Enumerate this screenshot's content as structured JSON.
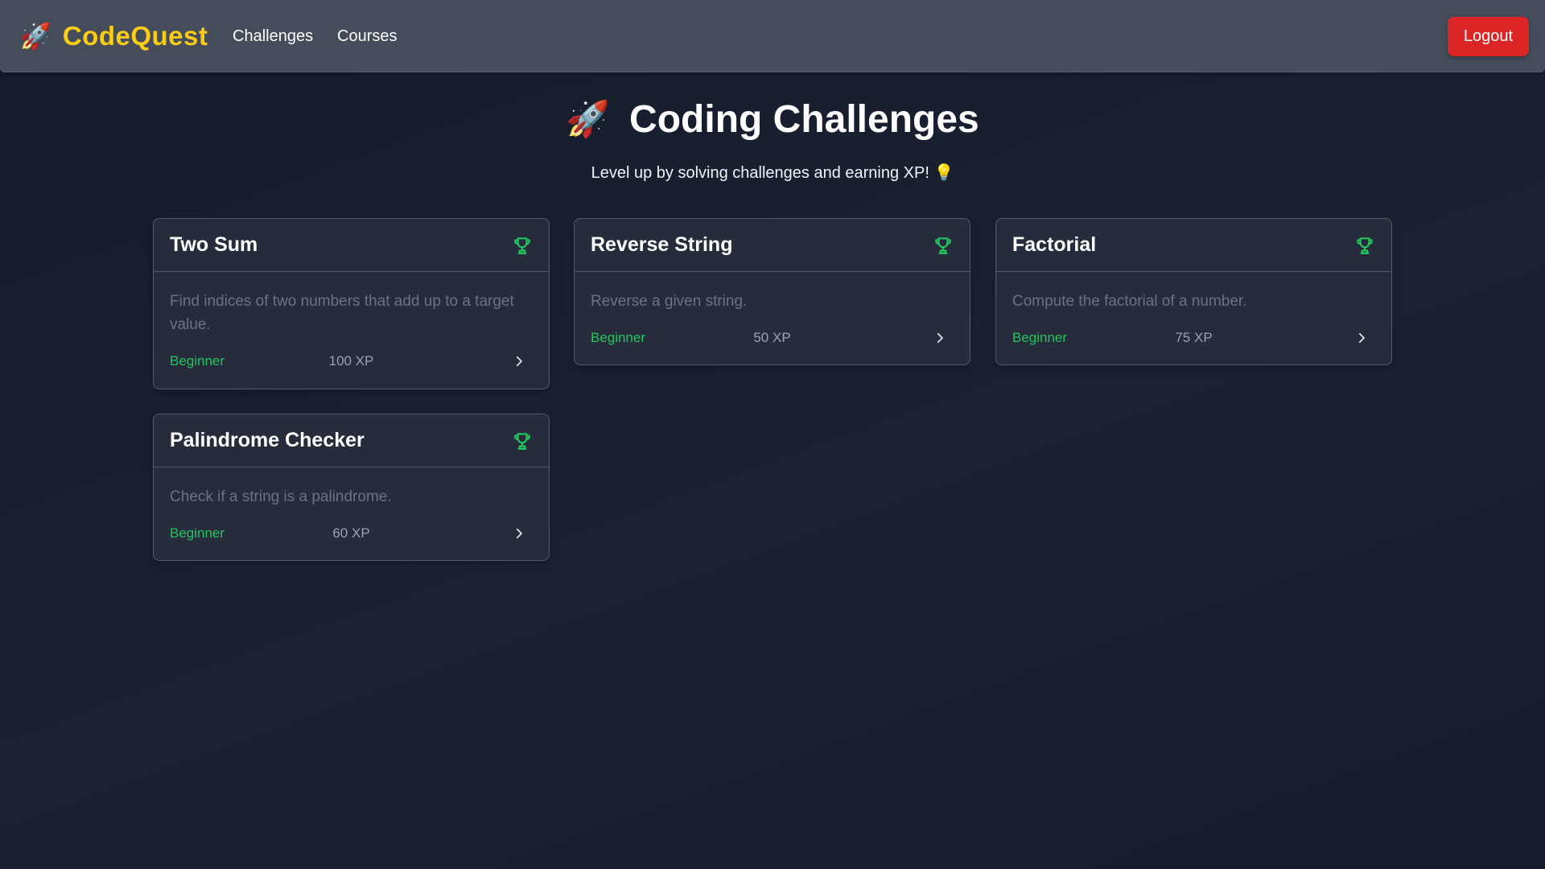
{
  "nav": {
    "brand_icon": "🚀",
    "brand_name": "CodeQuest",
    "links": [
      "Challenges",
      "Courses"
    ],
    "logout_label": "Logout"
  },
  "page": {
    "title_icon": "🚀",
    "title": "Coding Challenges",
    "subtitle": "Level up by solving challenges and earning XP! 💡"
  },
  "challenges": [
    {
      "title": "Two Sum",
      "description": "Find indices of two numbers that add up to a target value.",
      "level": "Beginner",
      "xp": "100 XP"
    },
    {
      "title": "Reverse String",
      "description": "Reverse a given string.",
      "level": "Beginner",
      "xp": "50 XP"
    },
    {
      "title": "Factorial",
      "description": "Compute the factorial of a number.",
      "level": "Beginner",
      "xp": "75 XP"
    },
    {
      "title": "Palindrome Checker",
      "description": "Check if a string is a palindrome.",
      "level": "Beginner",
      "xp": "60 XP"
    }
  ],
  "colors": {
    "brand": "#facc15",
    "accent_green": "#22c55e",
    "logout": "#dc2626",
    "card_bg": "#262c3b",
    "nav_bg": "#454c5a"
  },
  "icons": {
    "card_badge": "trophy-icon",
    "card_action": "chevron-right-icon"
  }
}
